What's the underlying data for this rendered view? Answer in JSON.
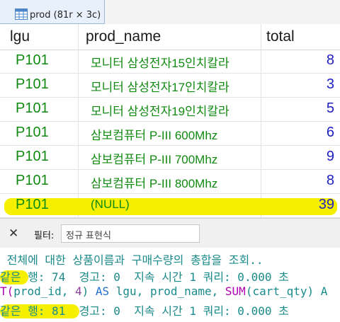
{
  "tab": {
    "label": "prod (81r × 3c)",
    "icon": "grid-table-icon"
  },
  "columns": [
    "lgu",
    "prod_name",
    "total"
  ],
  "rows": [
    {
      "lgu": "P101",
      "prod_name": "모니터 삼성전자15인치칼라",
      "total": "8"
    },
    {
      "lgu": "P101",
      "prod_name": "모니터 삼성전자17인치칼라",
      "total": "3"
    },
    {
      "lgu": "P101",
      "prod_name": "모니터 삼성전자19인치칼라",
      "total": "5"
    },
    {
      "lgu": "P101",
      "prod_name": "삼보컴퓨터 P-III 600Mhz",
      "total": "6"
    },
    {
      "lgu": "P101",
      "prod_name": "삼보컴퓨터 P-III 700Mhz",
      "total": "9"
    },
    {
      "lgu": "P101",
      "prod_name": "삼보컴퓨터 P-III 800Mhz",
      "total": "8"
    },
    {
      "lgu": "P101",
      "prod_name": "(NULL)",
      "total": "39"
    }
  ],
  "filter": {
    "close": "✕",
    "label": "필터:",
    "placeholder": "정규 표현식"
  },
  "log": {
    "line1": " 전체에 대한 상품이름과 구매수량의 총합을 조회..",
    "line2": "같은 행: 74  경고: 0  지속 시간 1 쿼리: 0.000 초",
    "line3a": "T(",
    "line3b": "prod_id, ",
    "line3c": "4",
    "line3d": ") ",
    "line3e": "AS",
    "line3f": " lgu, prod_name, ",
    "line3g": "SUM",
    "line3h": "(cart_qty) A",
    "line4": "같은 행: 81  경고: 0  지속 시간 1 쿼리: 0.000 초"
  },
  "colors": {
    "highlight": "#f5f000",
    "text_green": "#118a11",
    "text_blue": "#2020c0"
  }
}
